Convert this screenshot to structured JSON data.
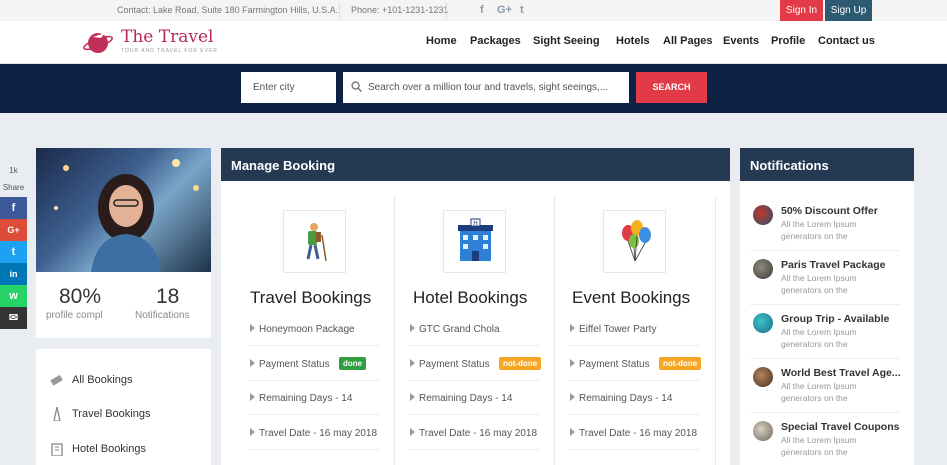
{
  "topbar": {
    "contact": "Contact: Lake Road, Suite 180 Farmington Hills, U.S.A.",
    "phone": "Phone: +101-1231-1231",
    "social": [
      "f",
      "G+",
      "t"
    ],
    "signin": "Sign In",
    "signup": "Sign Up"
  },
  "header": {
    "logo_title": "The Travel",
    "logo_sub": "TOUR AND TRAVEL FOR EVER",
    "nav": [
      "Home",
      "Packages",
      "Sight Seeing",
      "Hotels",
      "All Pages",
      "Events",
      "Profile",
      "Contact us"
    ]
  },
  "search": {
    "city_placeholder": "Enter city",
    "query_placeholder": "Search over a million tour and travels, sight seeings,...",
    "button": "SEARCH"
  },
  "share": {
    "count": "1k",
    "label": "Share",
    "buttons": [
      "f",
      "G+",
      "t",
      "in",
      "w",
      "✉"
    ]
  },
  "profile": {
    "percent": "80%",
    "percent_label": "profile compl",
    "notifications": "18",
    "notifications_label": "Notifications"
  },
  "left_menu": [
    "All Bookings",
    "Travel Bookings",
    "Hotel Bookings"
  ],
  "manage_booking": {
    "title": "Manage Booking",
    "columns": [
      {
        "title": "Travel Bookings",
        "rows": [
          "Honeymoon Package",
          "Payment Status",
          "Remaining Days - 14",
          "Travel Date - 16 may 2018"
        ],
        "status": "done"
      },
      {
        "title": "Hotel Bookings",
        "rows": [
          "GTC Grand Chola",
          "Payment Status",
          "Remaining Days - 14",
          "Travel Date - 16 may 2018"
        ],
        "status": "not-done"
      },
      {
        "title": "Event Bookings",
        "rows": [
          "Eiffel Tower Party",
          "Payment Status",
          "Remaining Days - 14",
          "Travel Date - 16 may 2018"
        ],
        "status": "not-done"
      }
    ]
  },
  "notifications": {
    "title": "Notifications",
    "items": [
      {
        "title": "50% Discount Offer",
        "sub": "All the Lorem Ipsum generators on the"
      },
      {
        "title": "Paris Travel Package",
        "sub": "All the Lorem Ipsum generators on the"
      },
      {
        "title": "Group Trip - Available",
        "sub": "All the Lorem Ipsum generators on the"
      },
      {
        "title": "World Best Travel Age...",
        "sub": "All the Lorem Ipsum generators on the"
      },
      {
        "title": "Special Travel Coupons",
        "sub": "All the Lorem Ipsum generators on the"
      }
    ]
  },
  "colors": {
    "accent": "#e23a47",
    "navy": "#0e2145",
    "panel_head": "#253a52",
    "done": "#2e9e3e",
    "not_done": "#f5a623"
  }
}
